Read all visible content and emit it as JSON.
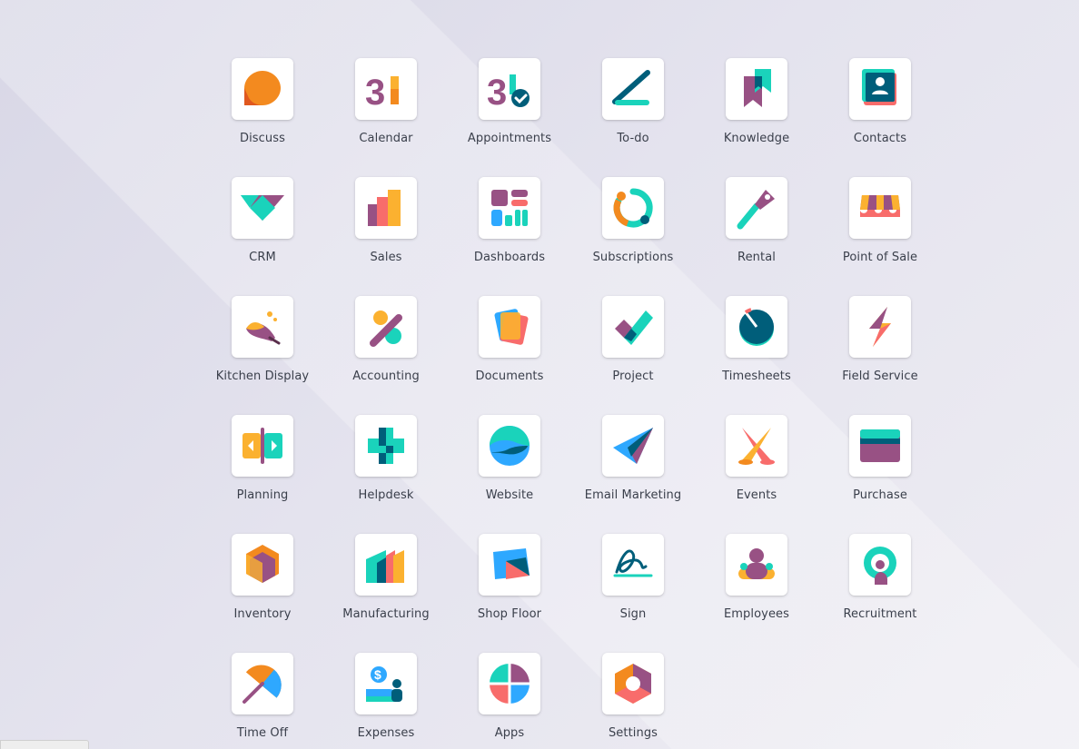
{
  "apps": [
    {
      "id": "discuss",
      "label": "Discuss",
      "icon": "discuss-icon"
    },
    {
      "id": "calendar",
      "label": "Calendar",
      "icon": "calendar-icon"
    },
    {
      "id": "appointments",
      "label": "Appointments",
      "icon": "appointments-icon"
    },
    {
      "id": "todo",
      "label": "To-do",
      "icon": "todo-icon"
    },
    {
      "id": "knowledge",
      "label": "Knowledge",
      "icon": "knowledge-icon"
    },
    {
      "id": "contacts",
      "label": "Contacts",
      "icon": "contacts-icon"
    },
    {
      "id": "crm",
      "label": "CRM",
      "icon": "crm-icon"
    },
    {
      "id": "sales",
      "label": "Sales",
      "icon": "sales-icon"
    },
    {
      "id": "dashboards",
      "label": "Dashboards",
      "icon": "dashboards-icon"
    },
    {
      "id": "subscriptions",
      "label": "Subscriptions",
      "icon": "subscriptions-icon"
    },
    {
      "id": "rental",
      "label": "Rental",
      "icon": "rental-icon"
    },
    {
      "id": "point-of-sale",
      "label": "Point of Sale",
      "icon": "point-of-sale-icon"
    },
    {
      "id": "kitchen-display",
      "label": "Kitchen Display",
      "icon": "kitchen-display-icon"
    },
    {
      "id": "accounting",
      "label": "Accounting",
      "icon": "accounting-icon"
    },
    {
      "id": "documents",
      "label": "Documents",
      "icon": "documents-icon"
    },
    {
      "id": "project",
      "label": "Project",
      "icon": "project-icon"
    },
    {
      "id": "timesheets",
      "label": "Timesheets",
      "icon": "timesheets-icon"
    },
    {
      "id": "field-service",
      "label": "Field Service",
      "icon": "field-service-icon"
    },
    {
      "id": "planning",
      "label": "Planning",
      "icon": "planning-icon"
    },
    {
      "id": "helpdesk",
      "label": "Helpdesk",
      "icon": "helpdesk-icon"
    },
    {
      "id": "website",
      "label": "Website",
      "icon": "website-icon"
    },
    {
      "id": "email-marketing",
      "label": "Email Marketing",
      "icon": "email-marketing-icon"
    },
    {
      "id": "events",
      "label": "Events",
      "icon": "events-icon"
    },
    {
      "id": "purchase",
      "label": "Purchase",
      "icon": "purchase-icon"
    },
    {
      "id": "inventory",
      "label": "Inventory",
      "icon": "inventory-icon"
    },
    {
      "id": "manufacturing",
      "label": "Manufacturing",
      "icon": "manufacturing-icon"
    },
    {
      "id": "shop-floor",
      "label": "Shop Floor",
      "icon": "shop-floor-icon"
    },
    {
      "id": "sign",
      "label": "Sign",
      "icon": "sign-icon"
    },
    {
      "id": "employees",
      "label": "Employees",
      "icon": "employees-icon"
    },
    {
      "id": "recruitment",
      "label": "Recruitment",
      "icon": "recruitment-icon"
    },
    {
      "id": "time-off",
      "label": "Time Off",
      "icon": "time-off-icon"
    },
    {
      "id": "expenses",
      "label": "Expenses",
      "icon": "expenses-icon"
    },
    {
      "id": "apps",
      "label": "Apps",
      "icon": "apps-icon"
    },
    {
      "id": "settings",
      "label": "Settings",
      "icon": "settings-icon"
    }
  ],
  "colors": {
    "purple": "#985184",
    "teal": "#1ad3bb",
    "orange": "#fbb130",
    "red": "#f86c6b",
    "blue": "#2ea8ff",
    "dark_teal": "#005e7a",
    "label": "#3a3f4b"
  }
}
